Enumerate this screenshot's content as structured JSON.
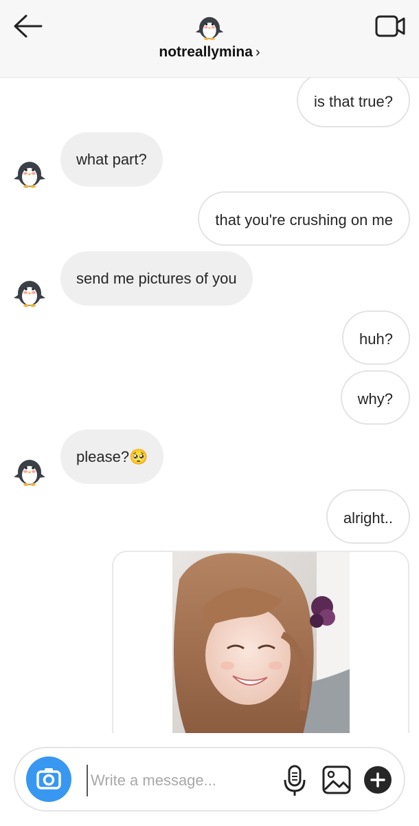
{
  "header": {
    "username": "notreallymina",
    "chevron": "›",
    "back_icon": "arrow-left-icon",
    "video_icon": "video-camera-icon",
    "avatar_icon": "penguin-avatar"
  },
  "messages": [
    {
      "side": "out",
      "text": "is that true?"
    },
    {
      "side": "in",
      "text": "what part?"
    },
    {
      "side": "out",
      "text": "that you're crushing on me"
    },
    {
      "side": "in",
      "text": "send me pictures of you"
    },
    {
      "side": "out",
      "text": "huh?"
    },
    {
      "side": "out",
      "text": "why?"
    },
    {
      "side": "in",
      "text": "please?",
      "emoji": "🥺"
    },
    {
      "side": "out",
      "text": "alright.."
    }
  ],
  "photo_message": {
    "side": "out",
    "kind": "photo"
  },
  "composer": {
    "placeholder": "Write a message...",
    "value": "",
    "camera_icon": "camera-icon",
    "mic_icon": "microphone-icon",
    "gallery_icon": "image-gallery-icon",
    "plus_icon": "plus-icon"
  },
  "colors": {
    "accent": "#3897f0",
    "incoming_bubble": "#efefef",
    "header_bg": "#f7f7f7"
  }
}
